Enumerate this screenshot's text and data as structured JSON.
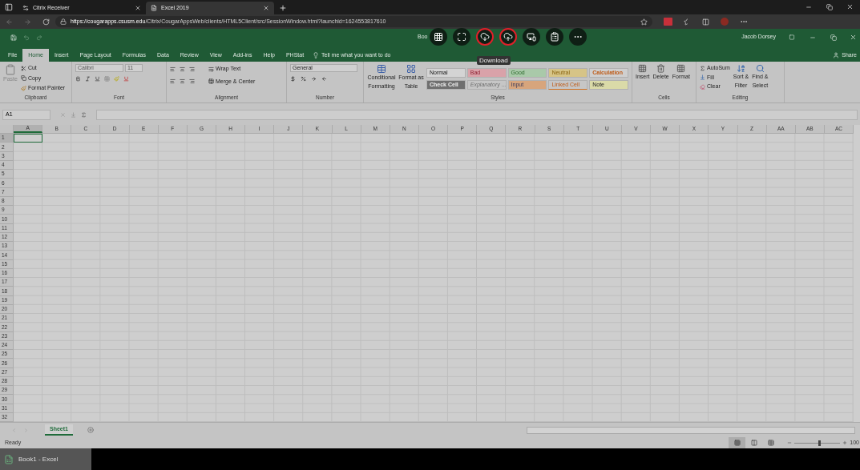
{
  "browser": {
    "tabs": [
      {
        "title": "Citrix Receiver",
        "selected": false
      },
      {
        "title": "Excel 2019",
        "selected": true
      }
    ],
    "url": {
      "host": "https://cougarapps.csusm.edu",
      "path": "/Citrix/CougarAppsWeb/clients/HTML5Client/src/SessionWindow.html?launchid=1624553817610"
    }
  },
  "excel": {
    "title": "Boo",
    "user": "Jacob Dorsey",
    "share": "Share",
    "ribbon_tabs": [
      {
        "label": "File",
        "selected": false
      },
      {
        "label": "Home",
        "selected": true
      },
      {
        "label": "Insert",
        "selected": false
      },
      {
        "label": "Page Layout",
        "selected": false
      },
      {
        "label": "Formulas",
        "selected": false
      },
      {
        "label": "Data",
        "selected": false
      },
      {
        "label": "Review",
        "selected": false
      },
      {
        "label": "View",
        "selected": false
      },
      {
        "label": "Add-ins",
        "selected": false
      },
      {
        "label": "Help",
        "selected": false
      },
      {
        "label": "PHStat",
        "selected": false
      }
    ],
    "tell_me": "Tell me what you want to do",
    "clipboard": {
      "paste": "Paste",
      "cut": "Cut",
      "copy": "Copy",
      "format_painter": "Format Painter",
      "label": "Clipboard"
    },
    "font": {
      "name": "Calibri",
      "size": "11",
      "label": "Font"
    },
    "alignment": {
      "wrap": "Wrap Text",
      "merge": "Merge & Center",
      "label": "Alignment"
    },
    "number": {
      "format": "General",
      "label": "Number"
    },
    "styles": {
      "conditional": "Conditional",
      "conditional_2": "Formatting",
      "format_table": "Format as",
      "format_table_2": "Table",
      "label": "Styles",
      "cells": [
        {
          "label": "Normal",
          "kind": "normal",
          "color": "#d4d4d4"
        },
        {
          "label": "Bad",
          "kind": "bad",
          "color": "#d9a2a9"
        },
        {
          "label": "Good",
          "kind": "good",
          "color": "#a9c9a9"
        },
        {
          "label": "Neutral",
          "kind": "neutral",
          "color": "#d6c487"
        },
        {
          "label": "Calculation",
          "kind": "calculation",
          "color": "#cfcfcf"
        },
        {
          "label": "Check Cell",
          "kind": "check",
          "color": "#6f6f6f"
        },
        {
          "label": "Explanatory ...",
          "kind": "explanatory",
          "color": "#c6c6c6"
        },
        {
          "label": "Input",
          "kind": "input",
          "color": "#d7a57c"
        },
        {
          "label": "Linked Cell",
          "kind": "linked",
          "color": "#c6c6c6"
        },
        {
          "label": "Note",
          "kind": "note",
          "color": "#dadaa8"
        }
      ]
    },
    "cells": {
      "insert": "Insert",
      "delete": "Delete",
      "format": "Format",
      "label": "Cells"
    },
    "editing": {
      "autosum": "AutoSum",
      "fill": "Fill",
      "clear": "Clear",
      "sort": "Sort &",
      "sort_2": "Filter",
      "find": "Find &",
      "find_2": "Select",
      "label": "Editing"
    },
    "name_box": "A1",
    "columns": [
      {
        "label": "A",
        "selected": true
      },
      {
        "label": "B",
        "selected": false
      },
      {
        "label": "C",
        "selected": false
      },
      {
        "label": "D",
        "selected": false
      },
      {
        "label": "E",
        "selected": false
      },
      {
        "label": "F",
        "selected": false
      },
      {
        "label": "G",
        "selected": false
      },
      {
        "label": "H",
        "selected": false
      },
      {
        "label": "I",
        "selected": false
      },
      {
        "label": "J",
        "selected": false
      },
      {
        "label": "K",
        "selected": false
      },
      {
        "label": "L",
        "selected": false
      },
      {
        "label": "M",
        "selected": false
      },
      {
        "label": "N",
        "selected": false
      },
      {
        "label": "O",
        "selected": false
      },
      {
        "label": "P",
        "selected": false
      },
      {
        "label": "Q",
        "selected": false
      },
      {
        "label": "R",
        "selected": false
      },
      {
        "label": "S",
        "selected": false
      },
      {
        "label": "T",
        "selected": false
      },
      {
        "label": "U",
        "selected": false
      },
      {
        "label": "V",
        "selected": false
      },
      {
        "label": "W",
        "selected": false
      },
      {
        "label": "X",
        "selected": false
      },
      {
        "label": "Y",
        "selected": false
      },
      {
        "label": "Z",
        "selected": false
      },
      {
        "label": "AA",
        "selected": false
      },
      {
        "label": "AB",
        "selected": false
      },
      {
        "label": "AC",
        "selected": false
      }
    ],
    "rows": [
      {
        "label": "1",
        "selected": true
      },
      {
        "label": "2",
        "selected": false
      },
      {
        "label": "3",
        "selected": false
      },
      {
        "label": "4",
        "selected": false
      },
      {
        "label": "5",
        "selected": false
      },
      {
        "label": "6",
        "selected": false
      },
      {
        "label": "7",
        "selected": false
      },
      {
        "label": "8",
        "selected": false
      },
      {
        "label": "9",
        "selected": false
      },
      {
        "label": "10",
        "selected": false
      },
      {
        "label": "11",
        "selected": false
      },
      {
        "label": "12",
        "selected": false
      },
      {
        "label": "13",
        "selected": false
      },
      {
        "label": "14",
        "selected": false
      },
      {
        "label": "15",
        "selected": false
      },
      {
        "label": "16",
        "selected": false
      },
      {
        "label": "17",
        "selected": false
      },
      {
        "label": "18",
        "selected": false
      },
      {
        "label": "19",
        "selected": false
      },
      {
        "label": "20",
        "selected": false
      },
      {
        "label": "21",
        "selected": false
      },
      {
        "label": "22",
        "selected": false
      },
      {
        "label": "23",
        "selected": false
      },
      {
        "label": "24",
        "selected": false
      },
      {
        "label": "25",
        "selected": false
      },
      {
        "label": "26",
        "selected": false
      },
      {
        "label": "27",
        "selected": false
      },
      {
        "label": "28",
        "selected": false
      },
      {
        "label": "29",
        "selected": false
      },
      {
        "label": "30",
        "selected": false
      },
      {
        "label": "31",
        "selected": false
      },
      {
        "label": "32",
        "selected": false
      }
    ],
    "sheets": [
      {
        "label": "Sheet1",
        "selected": true
      }
    ],
    "status": "Ready",
    "views": [
      {
        "kind": "normal",
        "selected": true
      },
      {
        "kind": "page_layout",
        "selected": false
      },
      {
        "kind": "page_break",
        "selected": false
      }
    ],
    "zoom": {
      "level": 0.52,
      "reading": "100"
    }
  },
  "citrix_toolbar": {
    "buttons": [
      {
        "kind": "logo",
        "highlighted": false
      },
      {
        "kind": "fullscreen",
        "highlighted": false
      },
      {
        "kind": "download",
        "highlighted": true
      },
      {
        "kind": "upload",
        "highlighted": true
      },
      {
        "kind": "monitors",
        "highlighted": false
      },
      {
        "kind": "clipboard",
        "highlighted": false
      },
      {
        "kind": "more",
        "highlighted": false
      }
    ],
    "tooltip": "Download"
  },
  "taskbar": {
    "app": "Book1 - Excel"
  }
}
